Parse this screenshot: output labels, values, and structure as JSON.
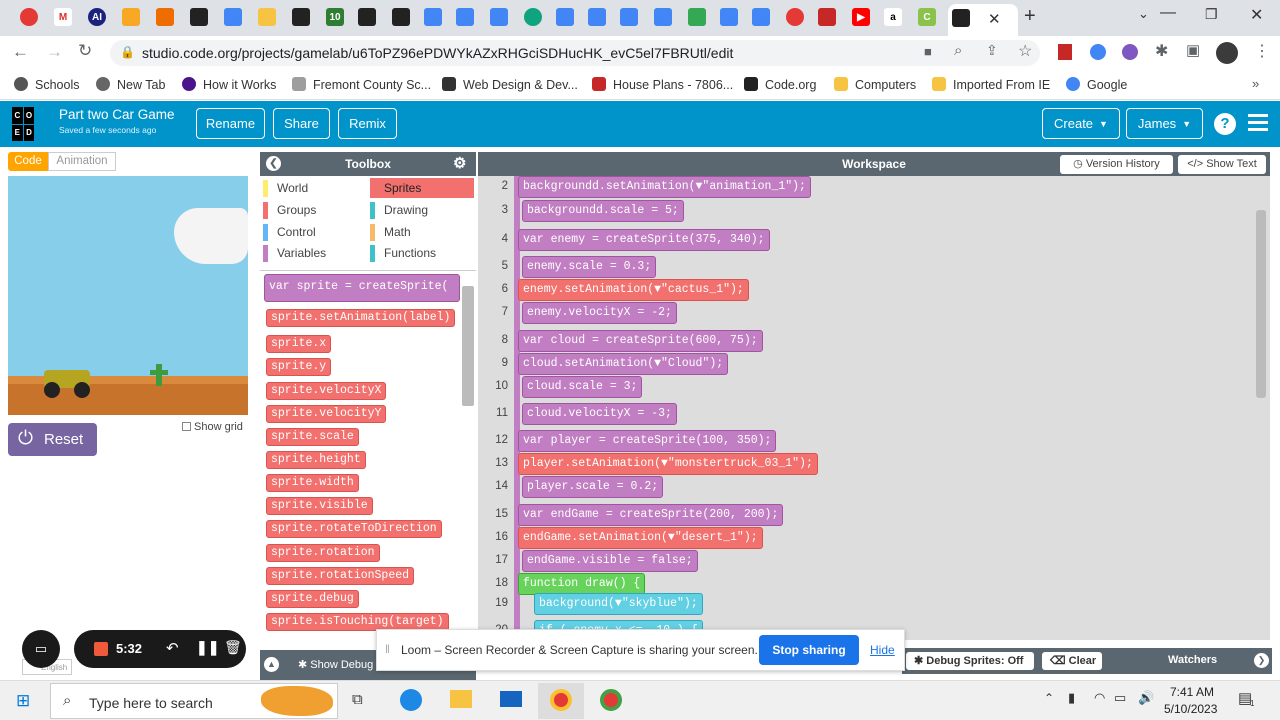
{
  "browser": {
    "url": "studio.code.org/projects/gamelab/u6ToPZ96ePDWYkAZxRHGciSDHucHK_evC5el7FBRUtl/edit",
    "bookmarks": [
      "Schools",
      "New Tab",
      "How it Works",
      "Fremont County Sc...",
      "Web Design & Dev...",
      "House Plans - 7806...",
      "Code.org",
      "Computers",
      "Imported From IE",
      "Google"
    ]
  },
  "header": {
    "project_title": "Part two Car Game",
    "saved_status": "Saved a few seconds ago",
    "logo_letters": [
      "C",
      "O",
      "D",
      "E"
    ],
    "rename_label": "Rename",
    "share_label": "Share",
    "remix_label": "Remix",
    "create_label": "Create",
    "user_label": "James"
  },
  "left": {
    "code_tab": "Code",
    "animation_tab": "Animation",
    "show_grid_label": "Show grid",
    "reset_label": "Reset",
    "language": "English"
  },
  "toolbox": {
    "title": "Toolbox",
    "categories": [
      "World",
      "Sprites",
      "Groups",
      "Drawing",
      "Control",
      "Math",
      "Variables",
      "Functions"
    ],
    "blocks": [
      "sprite.setAnimation(label)",
      "sprite.x",
      "sprite.y",
      "sprite.velocityX",
      "sprite.velocityY",
      "sprite.scale",
      "sprite.height",
      "sprite.width",
      "sprite.visible",
      "sprite.rotateToDirection",
      "sprite.rotation",
      "sprite.rotationSpeed",
      "sprite.debug",
      "sprite.isTouching(target)"
    ],
    "first_block": "var sprite = createSprite(",
    "show_debug": "Show Debug"
  },
  "workspace": {
    "title": "Workspace",
    "version_history": "Version History",
    "show_text": "Show Text",
    "lines": [
      {
        "n": "2",
        "text": "backgroundd.setAnimation(▼\"animation_1\");"
      },
      {
        "n": "3",
        "text": "backgroundd.scale = 5;"
      },
      {
        "n": "4",
        "text": "var enemy = createSprite(375, 340);"
      },
      {
        "n": "5",
        "text": "enemy.scale = 0.3;"
      },
      {
        "n": "6",
        "text": "enemy.setAnimation(▼\"cactus_1\");"
      },
      {
        "n": "7",
        "text": "enemy.velocityX = -2;"
      },
      {
        "n": "8",
        "text": "var cloud = createSprite(600, 75);"
      },
      {
        "n": "9",
        "text": "cloud.setAnimation(▼\"Cloud\");"
      },
      {
        "n": "10",
        "text": "cloud.scale = 3;"
      },
      {
        "n": "11",
        "text": "cloud.velocityX = -3;"
      },
      {
        "n": "12",
        "text": "var player = createSprite(100, 350);"
      },
      {
        "n": "13",
        "text": "player.setAnimation(▼\"monstertruck_03_1\");"
      },
      {
        "n": "14",
        "text": "player.scale = 0.2;"
      },
      {
        "n": "15",
        "text": "var endGame = createSprite(200, 200);"
      },
      {
        "n": "16",
        "text": "endGame.setAnimation(▼\"desert_1\");"
      },
      {
        "n": "17",
        "text": "endGame.visible = false;"
      },
      {
        "n": "18",
        "text": "function draw() {"
      },
      {
        "n": "19",
        "text": "background(▼\"skyblue\");"
      },
      {
        "n": "20",
        "text": "if ( enemy.x <= -10 ) {"
      }
    ],
    "debug_sprites": "Debug Sprites: Off",
    "clear": "Clear",
    "watchers": "Watchers"
  },
  "recorder": {
    "time": "5:32"
  },
  "loom": {
    "message": "Loom – Screen Recorder & Screen Capture is sharing your screen.",
    "stop_label": "Stop sharing",
    "hide_label": "Hide"
  },
  "taskbar": {
    "search_placeholder": "Type here to search",
    "time": "7:41 AM",
    "date": "5/10/2023",
    "notif_count": "1"
  },
  "colors": {
    "cdo_blue": "#0094ca",
    "purple": "#c27ec2",
    "sprite_red": "#f2706d",
    "stop_blue": "#1a73e8"
  }
}
